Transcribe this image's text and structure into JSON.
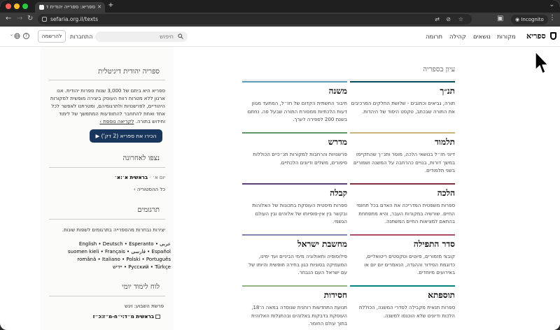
{
  "browser": {
    "tab_title": "ספריא: ספרייה יהודית דיגיטלית",
    "new_tab": "+",
    "url": "sefaria.org.il/texts",
    "incognito": "Incognito",
    "traffic_lights": [
      "#ff5f57",
      "#febc2e",
      "#28c840"
    ]
  },
  "header": {
    "logo": "ספריא",
    "nav": [
      "מקורות",
      "נושאים",
      "קהילה",
      "תרומה"
    ],
    "search_placeholder": "חיפוש",
    "login": "התחברות",
    "signup": "להרשמה"
  },
  "sidebar": {
    "library_title": "ספריה יהודית דיגיטלית",
    "library_text": "ספריא היא ביתם של 3,000 שנות ספרות יהודית. אנו ארגון ללא מטרות רווח העוסק ביצירה מופשית למקורות היהודיים, לפרשנויות ולתרגומיהם, ומטרתנו לאפשר לכל אחד ואחת להתחבר להתוודעות המתמשך של לימוד וחידוש בתורה.",
    "learn_more": "לקריאה נוספת ›",
    "intro_button": "הכירו את ספריא (2 דק')",
    "recent_title": "נצפו לאחרונה",
    "recent_item_ref": "בראשית א׳:א׳",
    "recent_item_time": "יום א׳ ·",
    "history_link": "כל ההסטוריה ›",
    "translations_title": "תרגומים",
    "translations_text": "יצירות נבחרות מהספרייה בתרגומים לשפות שונות.",
    "languages_row1": "عربى • English • Deutsch • Esperanto",
    "languages_row2": "Español • فارسی • suomen kieli • Français",
    "languages_row3": "română • Italiano • Polski • Português",
    "languages_row4": "Русский • Türkçe • יידיש",
    "daily_title": "לוח לימוד יומי",
    "parsha_label": "פרשת השבוע: ויגש",
    "parsha_ref": "בראשית מ״ד:י״ח-מ״ז:כ״ז"
  },
  "browse": {
    "title": "עיון בספריה",
    "categories": [
      {
        "name": "תנ״ך",
        "color": "#004e5f",
        "desc": "תורה, נביאים וכתובים - שלושת החלקים המרכיבים את התורה שבכתב, טקסט היסוד של היהדות."
      },
      {
        "name": "משנה",
        "color": "#5a99b7",
        "desc": "חיבור התשתית הקדום של חז״ל, המתעד מגוון דעות הלכתיות ממסורת התורה שבעל פה. נחתם בשנת 200 לספירה לערך."
      },
      {
        "name": "תלמוד",
        "color": "#ccb479",
        "desc": "דיוני חז״ל בנושאי הלכה, מוסר ותנ״ך שהתקיימו במשך דורות, בנויים כהרחבה על המשנה ושמורים בשני תלמודים."
      },
      {
        "name": "מדרש",
        "color": "#5d956f",
        "desc": "פרשנויות והרחבות למקורות תנ״כיים הכוללות סיפורים, משלים ודיונים הלכתיים."
      },
      {
        "name": "הלכה",
        "color": "#802f3e",
        "desc": "ספרות משפטית המדריכה את האדם בכל תחומי החיים. שורשיה במקורות העבר, והיא מתפתחת בהתאם למציאות החיים המשתנה."
      },
      {
        "name": "קבלה",
        "color": "#594176",
        "desc": "ספרות מיסטית העוסקת בתכונות של האלוהות ובקשר בין אין-סופיותו של אלוהים ובין העולם הגשמי."
      },
      {
        "name": "סדר התפילה",
        "color": "#ab4e66",
        "desc": "קובצי מזמורים, פיוטים וטקסטים ריטואליים, כדוגמת הסידור וההגדה, הנאמרים יום יום או באירועים מיוחדים."
      },
      {
        "name": "מחשבת ישראל",
        "color": "#7f85a9",
        "desc": "פילוסופיה ותאולוגיה מימי הביניים ועד ימינו, המעמיקה בסוגיות כגון בחירה חופשית והיותו של עם ישראל העם הנבחר."
      },
      {
        "name": "תוספתא",
        "color": "#00827f",
        "desc": "ספרות תנאית מקבילה לסדרי המשנה, הכוללת הלכות ודיונים שלא הוכנסו למשנה."
      },
      {
        "name": "חסידות",
        "color": "#97b386",
        "desc": "תנועת התחדשות רוחנית שנוסדה במאה ה־18, העוסקת בדבקות באלוהים ובהתגלות האלוהית בתוך עולם החומר."
      }
    ]
  }
}
